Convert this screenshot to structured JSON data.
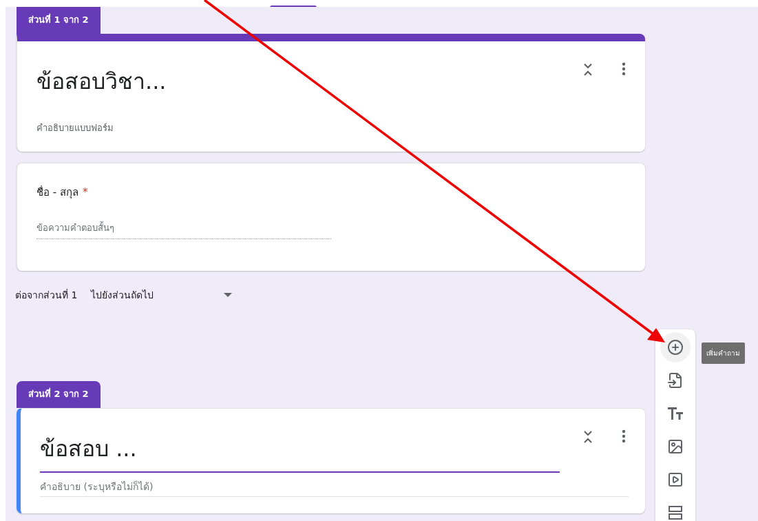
{
  "sections": [
    {
      "tab": "ส่วนที่ 1 จาก 2",
      "title": "ข้อสอบวิชา...",
      "description": "คำอธิบายแบบฟอร์ม",
      "focused": false,
      "questions": [
        {
          "title": "ชื่อ - สกุล",
          "required": true,
          "required_mark": "*",
          "placeholder": "ข้อความคำตอบสั้นๆ"
        }
      ],
      "after": {
        "label": "ต่อจากส่วนที่ 1",
        "value": "ไปยังส่วนถัดไป"
      }
    },
    {
      "tab": "ส่วนที่ 2 จาก 2",
      "title": "ข้อสอบ ...",
      "description_placeholder": "คำอธิบาย (ระบุหรือไม่ก็ได้)",
      "focused": true
    }
  ],
  "toolbar": {
    "tools": [
      {
        "kind": "add-question",
        "selected": true
      },
      {
        "kind": "import",
        "selected": false
      },
      {
        "kind": "title",
        "selected": false
      },
      {
        "kind": "image",
        "selected": false
      },
      {
        "kind": "video",
        "selected": false
      },
      {
        "kind": "section",
        "selected": false
      }
    ],
    "tooltip": "เพิ่มคำถาม"
  }
}
